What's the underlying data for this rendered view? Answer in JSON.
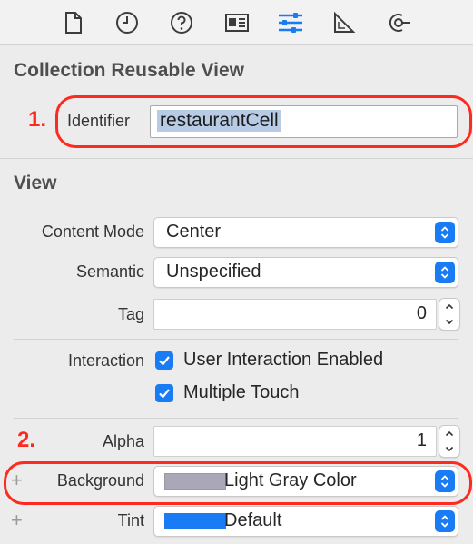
{
  "toolbar": {
    "icons": [
      "file-icon",
      "history-icon",
      "help-icon",
      "identity-icon",
      "attributes-icon",
      "size-icon",
      "connections-icon"
    ],
    "active_icon": "attributes-icon",
    "accent_color": "#1a7cf5"
  },
  "collection_reusable_view": {
    "title": "Collection Reusable View",
    "identifier_label": "Identifier",
    "identifier_value": "restaurantCell",
    "annotation": "1."
  },
  "view": {
    "title": "View",
    "content_mode_label": "Content Mode",
    "content_mode_value": "Center",
    "semantic_label": "Semantic",
    "semantic_value": "Unspecified",
    "tag_label": "Tag",
    "tag_value": "0",
    "interaction_label": "Interaction",
    "user_interaction_label": "User Interaction Enabled",
    "multiple_touch_label": "Multiple Touch",
    "alpha_label": "Alpha",
    "alpha_value": "1",
    "background_label": "Background",
    "background_value": "Light Gray Color",
    "background_swatch": "#aaa7b9",
    "tint_label": "Tint",
    "tint_value": "Default",
    "tint_swatch": "#1a7cf5",
    "annotation": "2.",
    "plus_symbol": "+"
  },
  "annotation_color": "#ff2a1f"
}
